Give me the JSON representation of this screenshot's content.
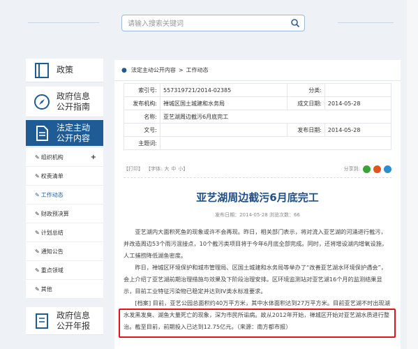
{
  "search": {
    "placeholder": "请输入搜索关键词"
  },
  "sidebar": {
    "cards": [
      {
        "label": "政策",
        "icon": "book-icon"
      },
      {
        "label_line1": "政府信息",
        "label_line2": "公开指南",
        "icon": "compass-icon"
      },
      {
        "label_line1": "法定主动",
        "label_line2": "公开内容",
        "icon": "document-icon"
      }
    ],
    "items": [
      {
        "label": "组织机构",
        "expand": "+"
      },
      {
        "label": "权责清单"
      },
      {
        "label": "工作动态"
      },
      {
        "label": "财政预决算"
      },
      {
        "label": "计划总结"
      },
      {
        "label": "通知公告"
      },
      {
        "label": "重点领域"
      },
      {
        "label": "其他"
      }
    ],
    "bottom": {
      "label_line1": "政府信息",
      "label_line2": "公开年报",
      "icon": "report-icon"
    }
  },
  "breadcrumb": {
    "parent": "法定主动公开内容",
    "sep": ">",
    "current": "工作动态"
  },
  "meta": {
    "index_label": "索引号:",
    "index_value": "557319721/2014-02385",
    "category_label": "分类:",
    "category_value": "",
    "org_label": "发布机构:",
    "org_value": "禅城区国土城建和水务局",
    "created_label": "成文日期:",
    "created_value": "2014-05-28",
    "name_label": "名称:",
    "name_value": "亚艺湖周边截污6月底完工",
    "docno_label": "文号:",
    "docno_value": "",
    "pub_label": "发布日期:",
    "pub_value": "2014-05-28",
    "topic_label": "主题词:",
    "topic_value": ""
  },
  "tools": {
    "print": "【打印】",
    "font": "【字体:",
    "big": "大",
    "mid": "中",
    "small": "小】",
    "share": "分享到:"
  },
  "share_icons": [
    {
      "name": "wechat-icon",
      "color": "#3aa43a"
    },
    {
      "name": "weibo-icon",
      "color": "#e0531b"
    },
    {
      "name": "qq-icon",
      "color": "#2a8fd1"
    }
  ],
  "article": {
    "title": "亚艺湖周边截污6月底完工",
    "meta": "发布日期：2014-05-28  浏览次数：66",
    "paragraphs": [
      "亚艺湖内大面积死鱼的现象或许不会再现。昨日，相关部门表示，将对流入亚艺湖的河涌进行截污，并改造周边53个雨污混接点，10个截污类项目将于今年6月底全部完成。同时，还将增设湖内增氧设施，人工捕捞降低湖鱼密度。",
      "昨日，禅城区环境保护和城市管理局、区国土城建和水务局等举办了“改善亚艺湖水环境保护遇会”，会上介绍了亚艺湖前期治理措施与效果及下阶段治理安排。区环境监测站对亚艺湖16个月的监测结果显示，目前工业特征污染物已稳定并达到IV类水标准要求。",
      "[档案]  目前，亚艺公园总面积约40万平方米，其中水体面积达到27万平方米。目前亚艺湖不时出现湖水发黑发臭、湖鱼大量死亡的现象，深为市民所诟病。故从2012年开始，禅城区开始对亚艺湖水质进行整治。截至目前，前期投入已达到12.75亿元。（来源：南方都市报）"
    ]
  },
  "colors": {
    "brand": "#1f5b94",
    "title": "#1f4f86",
    "highlight": "#e0151b"
  }
}
